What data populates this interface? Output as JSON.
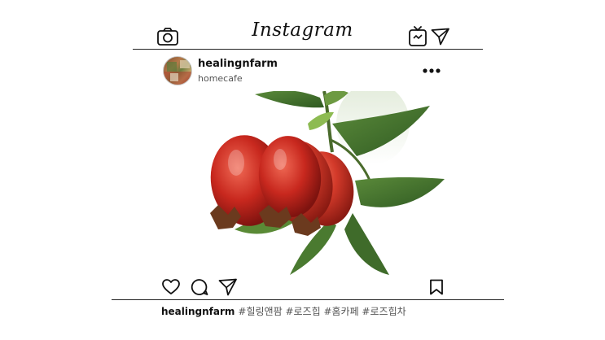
{
  "header": {
    "title": "Instagram",
    "icons": [
      "camera-icon",
      "igtv-icon",
      "direct-message-icon"
    ]
  },
  "post": {
    "username": "healingnfarm",
    "location": "homecafe",
    "more_icon": "more-options-icon",
    "image_subject": "rose hips on branch"
  },
  "actions": {
    "icons": [
      "like-heart-icon",
      "comment-icon",
      "share-icon",
      "bookmark-icon"
    ]
  },
  "caption": {
    "username": "healingnfarm",
    "hashtags": "#힐링앤팜 #로즈힙 #홈카페 #로즈힙차"
  }
}
